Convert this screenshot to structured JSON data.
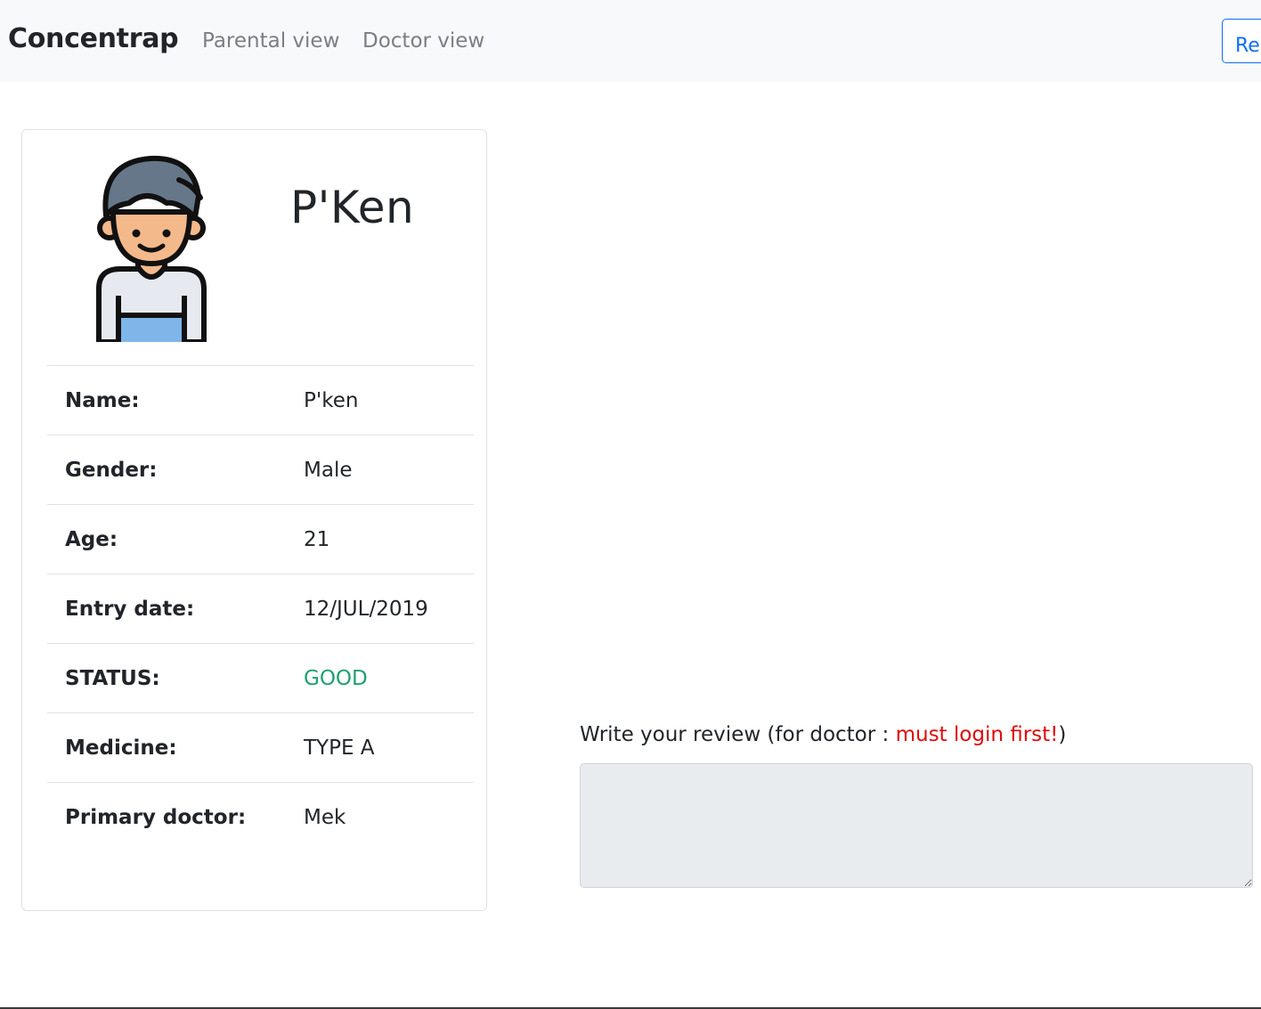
{
  "navbar": {
    "brand": "Concentrap",
    "links": [
      "Parental view",
      "Doctor view"
    ],
    "register_label": "Register"
  },
  "profile": {
    "title": "P'Ken",
    "avatar_icon": "boy-avatar-icon",
    "fields": [
      {
        "label": "Name:",
        "value": "P'ken"
      },
      {
        "label": "Gender:",
        "value": "Male"
      },
      {
        "label": "Age:",
        "value": "21"
      },
      {
        "label": "Entry date:",
        "value": "12/JUL/2019"
      },
      {
        "label": "STATUS:",
        "value": "GOOD"
      },
      {
        "label": "Medicine:",
        "value": "TYPE A"
      },
      {
        "label": "Primary doctor:",
        "value": "Mek"
      }
    ]
  },
  "review": {
    "label_prefix": "Write your review (for doctor : ",
    "label_warning": "must login first!",
    "label_suffix": ")",
    "value": ""
  },
  "colors": {
    "status_good": "#20a070",
    "warning": "#e00b0b",
    "primary": "#0d6efd",
    "navbar_bg": "#f8f9fa"
  }
}
